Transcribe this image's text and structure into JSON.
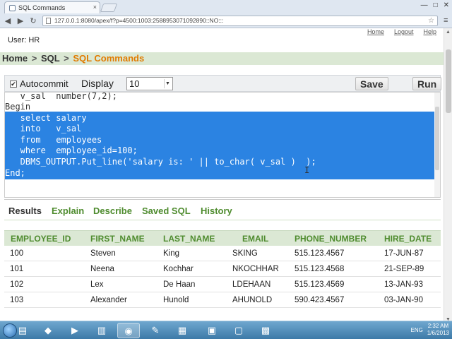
{
  "browser": {
    "tab_title": "SQL Commands",
    "url": "127.0.0.1:8080/apex/f?p=4500:1003:2588953071092890::NO:::",
    "tab_close": "×",
    "win_min": "—",
    "win_max": "□",
    "win_close": "✕"
  },
  "header": {
    "user": "User: HR",
    "links": [
      "Home",
      "Logout",
      "Help"
    ]
  },
  "breadcrumb": {
    "home": "Home",
    "sql": "SQL",
    "current": "SQL Commands",
    "separator": ">"
  },
  "toolbar": {
    "autocommit_label": "Autocommit",
    "autocommit_checked": "✔",
    "display_label": "Display",
    "display_value": "10",
    "save_label": "Save",
    "run_label": "Run"
  },
  "editor": {
    "lines": [
      "   v_sal  number(7,2);",
      "Begin",
      "   select salary",
      "   into   v_sal",
      "   from   employees",
      "   where  employee_id=100;",
      "   DBMS_OUTPUT.Put_line('salary is: ' || to_char( v_sal )  );",
      "End;"
    ]
  },
  "results_tabs": [
    "Results",
    "Explain",
    "Describe",
    "Saved SQL",
    "History"
  ],
  "table": {
    "columns": [
      "EMPLOYEE_ID",
      "FIRST_NAME",
      "LAST_NAME",
      "EMAIL",
      "PHONE_NUMBER",
      "HIRE_DATE"
    ],
    "rows": [
      [
        "100",
        "Steven",
        "King",
        "SKING",
        "515.123.4567",
        "17-JUN-87"
      ],
      [
        "101",
        "Neena",
        "Kochhar",
        "NKOCHHAR",
        "515.123.4568",
        "21-SEP-89"
      ],
      [
        "102",
        "Lex",
        "De Haan",
        "LDEHAAN",
        "515.123.4569",
        "13-JAN-93"
      ],
      [
        "103",
        "Alexander",
        "Hunold",
        "AHUNOLD",
        "590.423.4567",
        "03-JAN-90"
      ]
    ]
  },
  "taskbar": {
    "icons": [
      "explorer-icon",
      "visual-studio-icon",
      "media-player-icon",
      "winrar-icon",
      "chrome-icon",
      "paint-icon",
      "excel-icon",
      "powerpoint-icon",
      "notepad-icon",
      "sql-icon"
    ],
    "lang": "ENG",
    "time": "2:32 AM",
    "date": "1/6/2013"
  },
  "colors": {
    "accent_green": "#4f8c2f",
    "breadcrumb_orange": "#e07b00",
    "selection_blue": "#2b83e2",
    "header_band": "#dbe8d4"
  }
}
